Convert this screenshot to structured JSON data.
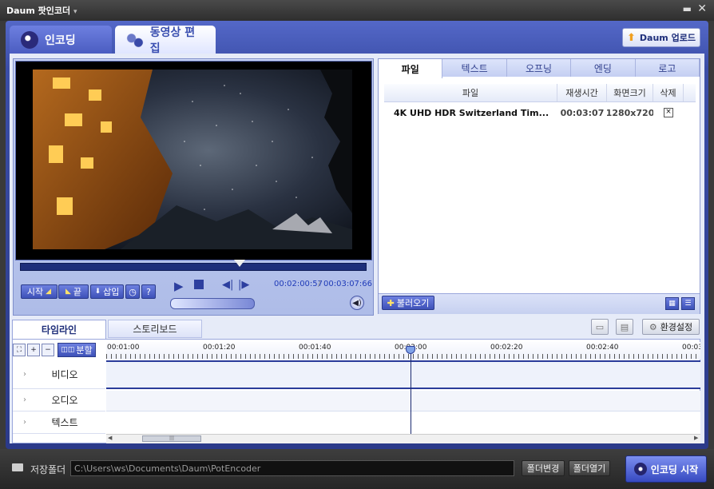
{
  "app": {
    "title": "Daum 팟인코더",
    "title_caret": "▾",
    "minimize": "▬",
    "close": "✕"
  },
  "top_tabs": {
    "encode": "인코딩",
    "edit": "동영상 편집"
  },
  "upload_button": "Daum 업로드",
  "player": {
    "start_label": "시작",
    "end_label": "끝",
    "insert_label": "삽입",
    "help_label": "?",
    "time_current": "00:02:00:57",
    "time_separator": "/",
    "time_total": "00:03:07:66",
    "progress": 0.64
  },
  "right_tabs": [
    "파일",
    "텍스트",
    "오프닝",
    "엔딩",
    "로고"
  ],
  "file_table": {
    "headers": [
      "파일",
      "재생시간",
      "화면크기",
      "삭제"
    ],
    "rows": [
      {
        "name": "4K UHD HDR Switzerland Tim...",
        "duration": "00:03:07",
        "size": "1280x720",
        "delete": "×"
      }
    ]
  },
  "load_button": "불러오기",
  "timeline": {
    "tab_timeline": "타임라인",
    "tab_storyboard": "스토리보드",
    "settings_label": "환경설정",
    "split_label": "분할",
    "ruler": [
      "00:01:00",
      "00:01:20",
      "00:01:40",
      "00:02:00",
      "00:02:20",
      "00:02:40",
      "00:03"
    ],
    "tracks": {
      "video": "비디오",
      "audio": "오디오",
      "text": "텍스트"
    }
  },
  "bottom": {
    "save_folder_label": "저장폴더",
    "path": "C:\\Users\\ws\\Documents\\Daum\\PotEncoder",
    "change_folder": "폴더변경",
    "open_folder": "폴더열기",
    "start_encode": "인코딩 시작"
  }
}
